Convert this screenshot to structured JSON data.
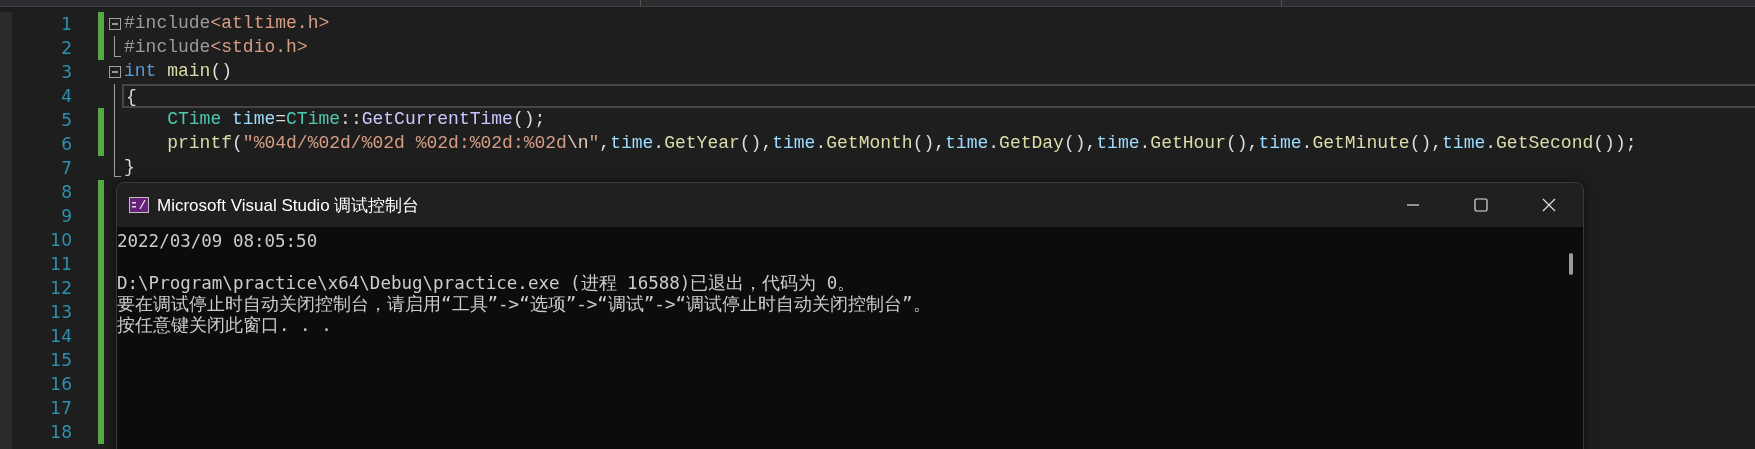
{
  "editor": {
    "lines": [
      {
        "number": "1",
        "changed": true,
        "current": false,
        "expanded": true,
        "tokens": [
          {
            "kind": "preproc",
            "text": "#include"
          },
          {
            "kind": "path",
            "text": "<atltime.h>"
          }
        ],
        "children": [
          {
            "number": "2",
            "changed": true,
            "current": false,
            "tokens": [
              {
                "kind": "preproc",
                "text": "#include"
              },
              {
                "kind": "path",
                "text": "<stdio.h>"
              }
            ]
          }
        ]
      },
      {
        "number": "3",
        "changed": false,
        "current": false,
        "expanded": true,
        "tokens": [
          {
            "kind": "keyword",
            "text": "int "
          },
          {
            "kind": "func",
            "text": "main"
          },
          {
            "kind": "plain",
            "text": "()"
          }
        ],
        "children": [
          {
            "number": "4",
            "changed": false,
            "current": true,
            "tokens": [
              {
                "kind": "plain",
                "text": "{"
              }
            ]
          },
          {
            "number": "5",
            "changed": true,
            "current": false,
            "tokens": [
              {
                "kind": "type",
                "text": "    CTime "
              },
              {
                "kind": "var",
                "text": "time"
              },
              {
                "kind": "plain",
                "text": "="
              },
              {
                "kind": "type",
                "text": "CTime"
              },
              {
                "kind": "plain",
                "text": "::"
              },
              {
                "kind": "method",
                "text": "GetCurrentTime"
              },
              {
                "kind": "plain",
                "text": "();"
              }
            ]
          },
          {
            "number": "6",
            "changed": true,
            "current": false,
            "tokens": [
              {
                "kind": "func",
                "text": "    printf"
              },
              {
                "kind": "plain",
                "text": "("
              },
              {
                "kind": "string",
                "text": "\"%04d/%02d/%02d %02d:%02d:%02d"
              },
              {
                "kind": "escape",
                "text": "\\n"
              },
              {
                "kind": "string",
                "text": "\""
              },
              {
                "kind": "plain",
                "text": ","
              },
              {
                "kind": "var",
                "text": "time"
              },
              {
                "kind": "plain",
                "text": "."
              },
              {
                "kind": "func",
                "text": "GetYear"
              },
              {
                "kind": "plain",
                "text": "(),"
              },
              {
                "kind": "var",
                "text": "time"
              },
              {
                "kind": "plain",
                "text": "."
              },
              {
                "kind": "func",
                "text": "GetMonth"
              },
              {
                "kind": "plain",
                "text": "(),"
              },
              {
                "kind": "var",
                "text": "time"
              },
              {
                "kind": "plain",
                "text": "."
              },
              {
                "kind": "func",
                "text": "GetDay"
              },
              {
                "kind": "plain",
                "text": "(),"
              },
              {
                "kind": "var",
                "text": "time"
              },
              {
                "kind": "plain",
                "text": "."
              },
              {
                "kind": "func",
                "text": "GetHour"
              },
              {
                "kind": "plain",
                "text": "(),"
              },
              {
                "kind": "var",
                "text": "time"
              },
              {
                "kind": "plain",
                "text": "."
              },
              {
                "kind": "func",
                "text": "GetMinute"
              },
              {
                "kind": "plain",
                "text": "(),"
              },
              {
                "kind": "var",
                "text": "time"
              },
              {
                "kind": "plain",
                "text": "."
              },
              {
                "kind": "func",
                "text": "GetSecond"
              },
              {
                "kind": "plain",
                "text": "());"
              }
            ]
          },
          {
            "number": "7",
            "changed": false,
            "current": false,
            "tokens": [
              {
                "kind": "plain",
                "text": "}"
              }
            ]
          }
        ]
      },
      {
        "number": "8",
        "changed": true,
        "current": false
      },
      {
        "number": "9",
        "changed": true,
        "current": false
      },
      {
        "number": "10",
        "changed": true,
        "current": false
      },
      {
        "number": "11",
        "changed": true,
        "current": false
      },
      {
        "number": "12",
        "changed": true,
        "current": false
      },
      {
        "number": "13",
        "changed": true,
        "current": false
      },
      {
        "number": "14",
        "changed": true,
        "current": false
      },
      {
        "number": "15",
        "changed": true,
        "current": false
      },
      {
        "number": "16",
        "changed": true,
        "current": false
      },
      {
        "number": "17",
        "changed": true,
        "current": false
      },
      {
        "number": "18",
        "changed": true,
        "current": false
      }
    ]
  },
  "console": {
    "title": "Microsoft Visual Studio 调试控制台",
    "output": [
      "2022/03/09 08:05:50"
    ],
    "messages": [
      "D:\\Program\\practice\\x64\\Debug\\practice.exe (进程 16588)已退出，代码为 0。",
      "要在调试停止时自动关闭控制台，请启用“工具”->“选项”->“调试”->“调试停止时自动关闭控制台”。",
      "按任意键关闭此窗口. . ."
    ]
  }
}
